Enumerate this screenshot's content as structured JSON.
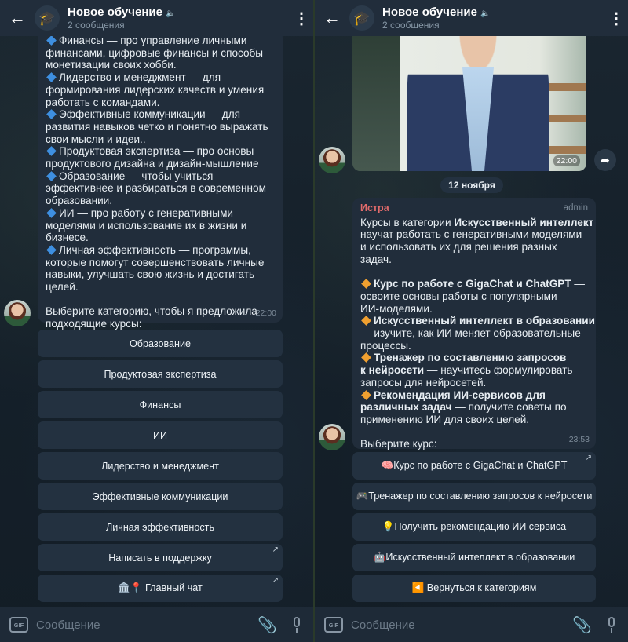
{
  "header": {
    "title": "Новое обучение",
    "subtitle": "2 сообщения"
  },
  "composer": {
    "placeholder": "Сообщение",
    "gif_label": "GIF"
  },
  "left": {
    "message_lines": [
      {
        "icon": true,
        "text": "Финансы — про управление личными"
      },
      {
        "icon": false,
        "text": "финансами, цифровые финансы и способы"
      },
      {
        "icon": false,
        "text": "монетизации своих хобби."
      },
      {
        "icon": true,
        "text": "Лидерство и менеджмент — для"
      },
      {
        "icon": false,
        "text": "формирования лидерских качеств и умения"
      },
      {
        "icon": false,
        "text": "работать с командами."
      },
      {
        "icon": true,
        "text": "Эффективные коммуникации — для"
      },
      {
        "icon": false,
        "text": "развития навыков четко и понятно выражать"
      },
      {
        "icon": false,
        "text": "свои мысли и идеи.."
      },
      {
        "icon": true,
        "text": "Продуктовая экспертиза — про основы"
      },
      {
        "icon": false,
        "text": "продуктового дизайна и дизайн-мышление"
      },
      {
        "icon": true,
        "text": "Образование — чтобы учиться"
      },
      {
        "icon": false,
        "text": "эффективнее и разбираться в современном"
      },
      {
        "icon": false,
        "text": "образовании."
      },
      {
        "icon": true,
        "text": "ИИ — про работу с генеративными"
      },
      {
        "icon": false,
        "text": "моделями и использование их в жизни и"
      },
      {
        "icon": false,
        "text": "бизнесе."
      },
      {
        "icon": true,
        "text": "Личная эффективность — программы,"
      },
      {
        "icon": false,
        "text": "которые помогут совершенствовать личные"
      },
      {
        "icon": false,
        "text": "навыки, улучшать свою жизнь и достигать"
      },
      {
        "icon": false,
        "text": "целей."
      },
      {
        "icon": false,
        "text": ""
      },
      {
        "icon": false,
        "text": "Выберите категорию, чтобы я предложила"
      },
      {
        "icon": false,
        "text": "подходящие курсы:"
      }
    ],
    "time": "22:00",
    "buttons": [
      {
        "label": "Образование",
        "link": false
      },
      {
        "label": "Продуктовая экспертиза",
        "link": false
      },
      {
        "label": "Финансы",
        "link": false
      },
      {
        "label": "ИИ",
        "link": false
      },
      {
        "label": "Лидерство и менеджмент",
        "link": false
      },
      {
        "label": "Эффективные коммуникации",
        "link": false
      },
      {
        "label": "Личная эффективность",
        "link": false
      },
      {
        "label": "Написать в поддержку",
        "link": true
      },
      {
        "label": "🏛️📍 Главный чат",
        "link": true
      }
    ]
  },
  "right": {
    "photo_time": "22:00",
    "date_pill": "12 ноября",
    "sender": "Истра",
    "sender_role": "admin",
    "time": "23:53",
    "lines": [
      [
        {
          "t": "Курсы в категории "
        },
        {
          "t": "Искусственный интеллект",
          "b": true
        }
      ],
      [
        {
          "t": "научат работать с генеративными моделями"
        }
      ],
      [
        {
          "t": "и использовать их для решения разных"
        }
      ],
      [
        {
          "t": "задач."
        }
      ],
      [],
      [
        {
          "icon": true
        },
        {
          "t": "Курс по работе с GigaChat и ChatGPT",
          "b": true
        },
        {
          "t": " —"
        }
      ],
      [
        {
          "t": "освоите основы работы с популярными"
        }
      ],
      [
        {
          "t": "ИИ-моделями."
        }
      ],
      [
        {
          "icon": true
        },
        {
          "t": "Искусственный интеллект в образовании",
          "b": true
        }
      ],
      [
        {
          "t": "— изучите, как ИИ меняет образовательные"
        }
      ],
      [
        {
          "t": "процессы."
        }
      ],
      [
        {
          "icon": true
        },
        {
          "t": "Тренажер по составлению запросов",
          "b": true
        }
      ],
      [
        {
          "t": "к нейросети",
          "b": true
        },
        {
          "t": " — научитесь формулировать"
        }
      ],
      [
        {
          "t": "запросы для нейросетей."
        }
      ],
      [
        {
          "icon": true
        },
        {
          "t": "Рекомендация ИИ-сервисов для",
          "b": true
        }
      ],
      [
        {
          "t": "различных задач",
          "b": true
        },
        {
          "t": " — получите советы по"
        }
      ],
      [
        {
          "t": "применению ИИ для своих целей."
        }
      ],
      [],
      [
        {
          "t": "Выберите курс:"
        }
      ]
    ],
    "buttons": [
      {
        "label": "🧠Курс по работе с GigaChat и ChatGPT",
        "link": true
      },
      {
        "label": "🎮Тренажер по составлению запросов к нейросети",
        "link": false
      },
      {
        "label": "💡Получить рекомендацию ИИ сервиса",
        "link": false
      },
      {
        "label": "🤖Искусственный интеллект в образовании",
        "link": false
      },
      {
        "label": "◀️ Вернуться к категориям",
        "link": false
      }
    ]
  }
}
